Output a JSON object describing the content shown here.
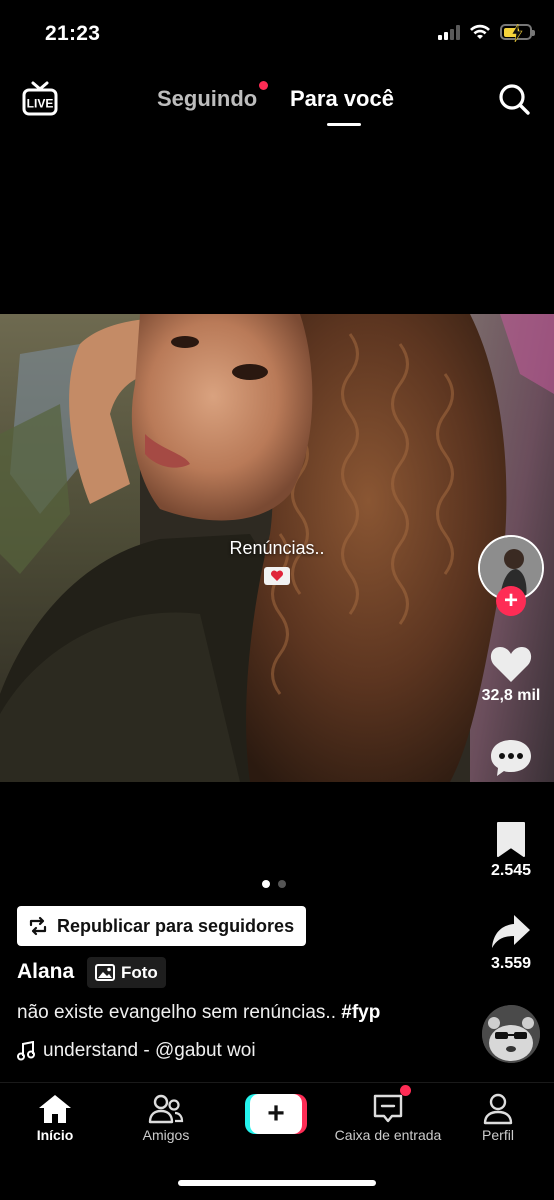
{
  "status_bar": {
    "time": "21:23",
    "battery_color": "#f5d33b"
  },
  "top_nav": {
    "live_label": "LIVE",
    "following_label": "Seguindo",
    "for_you_label": "Para você",
    "active_tab": "Para você",
    "notification_dot_color": "#fe2c55"
  },
  "post": {
    "overlay_text": "Renúncias..",
    "overlay_icon": "heart-envelope-icon",
    "likes": "32,8 mil",
    "saves": "2.545",
    "shares": "3.559",
    "carousel_pages": 2,
    "carousel_current": 1,
    "repost_label": "Republicar para seguidores",
    "username": "Alana",
    "type_label": "Foto",
    "caption_text": "não existe evangelho sem renúncias..",
    "caption_hashtag": "#fyp",
    "music": "understand - @gabut woi"
  },
  "tab_bar": {
    "home": "Início",
    "friends": "Amigos",
    "inbox": "Caixa de entrada",
    "profile": "Perfil",
    "accent_left": "#25f4ee",
    "accent_right": "#fe2c55"
  }
}
